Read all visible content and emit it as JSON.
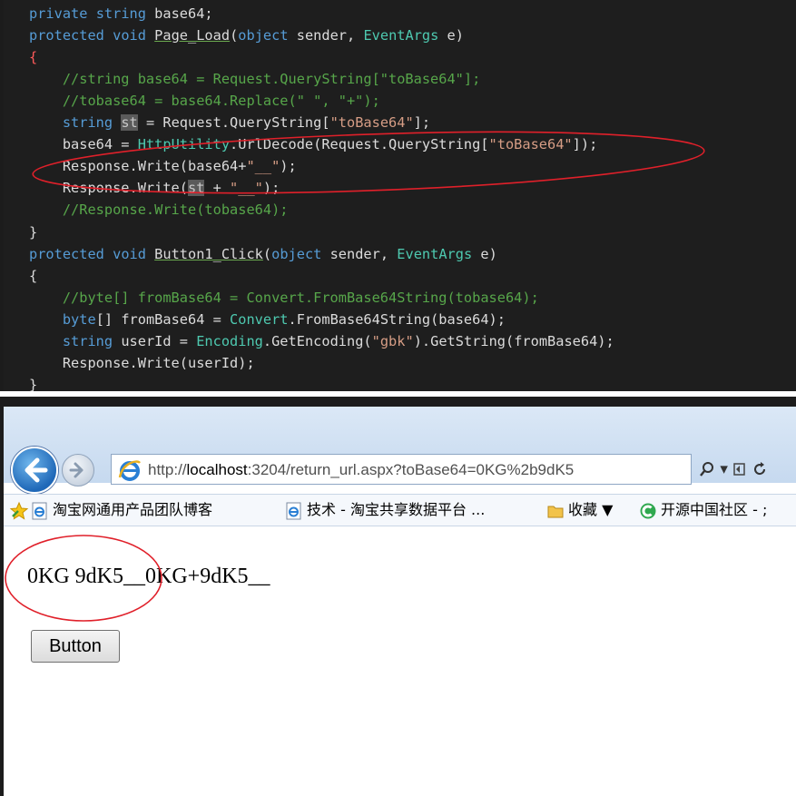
{
  "code": {
    "lines": [
      [
        {
          "t": "private ",
          "c": "kw"
        },
        {
          "t": "string ",
          "c": "kw"
        },
        {
          "t": "base64;"
        }
      ],
      [
        {
          "t": "protected ",
          "c": "kw"
        },
        {
          "t": "void ",
          "c": "kw"
        },
        {
          "t": "Page_Load",
          "c": "ul-green"
        },
        {
          "t": "("
        },
        {
          "t": "object ",
          "c": "kw"
        },
        {
          "t": "sender, "
        },
        {
          "t": "EventArgs ",
          "c": "ty"
        },
        {
          "t": "e)"
        }
      ],
      [
        {
          "t": "{",
          "c": "red-brace"
        }
      ],
      [
        {
          "t": "    //string base64 = Request.QueryString[\"toBase64\"];",
          "c": "cm"
        }
      ],
      [
        {
          "t": "    //tobase64 = base64.Replace(\" \", \"+\");",
          "c": "cm"
        }
      ],
      [
        {
          "t": "    "
        },
        {
          "t": "string ",
          "c": "kw"
        },
        {
          "t": "st",
          "c": "hl"
        },
        {
          "t": " = Request.QueryString["
        },
        {
          "t": "\"toBase64\"",
          "c": "st"
        },
        {
          "t": "];"
        }
      ],
      [
        {
          "t": "    base64 = "
        },
        {
          "t": "HttpUtility",
          "c": "ty"
        },
        {
          "t": ".UrlDecode(Request.QueryString["
        },
        {
          "t": "\"toBase64\"",
          "c": "st"
        },
        {
          "t": "]);"
        }
      ],
      [
        {
          "t": "    Response.Write(base64+"
        },
        {
          "t": "\"__\"",
          "c": "st"
        },
        {
          "t": ");"
        }
      ],
      [
        {
          "t": "    Response.Write("
        },
        {
          "t": "st",
          "c": "hl"
        },
        {
          "t": " + "
        },
        {
          "t": "\"__\"",
          "c": "st"
        },
        {
          "t": ");"
        }
      ],
      [
        {
          "t": "    //Response.Write(tobase64);",
          "c": "cm"
        }
      ],
      [
        {
          "t": "}"
        }
      ],
      [
        {
          "t": "protected ",
          "c": "kw"
        },
        {
          "t": "void ",
          "c": "kw"
        },
        {
          "t": "Button1_Click",
          "c": "ul-green"
        },
        {
          "t": "("
        },
        {
          "t": "object ",
          "c": "kw"
        },
        {
          "t": "sender, "
        },
        {
          "t": "EventArgs ",
          "c": "ty"
        },
        {
          "t": "e)"
        }
      ],
      [
        {
          "t": "{"
        }
      ],
      [
        {
          "t": "    //byte[] fromBase64 = Convert.FromBase64String(tobase64);",
          "c": "cm"
        }
      ],
      [
        {
          "t": "    "
        },
        {
          "t": "byte",
          "c": "kw"
        },
        {
          "t": "[] fromBase64 = "
        },
        {
          "t": "Convert",
          "c": "ty"
        },
        {
          "t": ".FromBase64String(base64);"
        }
      ],
      [
        {
          "t": "    "
        },
        {
          "t": "string ",
          "c": "kw"
        },
        {
          "t": "userId = "
        },
        {
          "t": "Encoding",
          "c": "ty"
        },
        {
          "t": ".GetEncoding("
        },
        {
          "t": "\"gbk\"",
          "c": "st"
        },
        {
          "t": ").GetString(fromBase64);"
        }
      ],
      [
        {
          "t": "    Response.Write(userId);"
        }
      ],
      [
        {
          "t": "}"
        }
      ]
    ],
    "annotation_color": "#e0202a"
  },
  "browser": {
    "url_scheme": "http://",
    "url_host": "localhost",
    "url_rest": ":3204/return_url.aspx?toBase64=0KG%2b9dK5",
    "search_icon": "magnifier-icon",
    "dropdown_glyph": "▾",
    "favorites": [
      {
        "label": "淘宝网通用产品团队博客",
        "icon": "ie-page-icon"
      },
      {
        "label": "技术 - 淘宝共享数据平台 ...",
        "icon": "ie-page-icon"
      },
      {
        "label": "收藏 ▼",
        "icon": "folder-icon"
      },
      {
        "label": "开源中国社区 - ;",
        "icon": "oschina-icon"
      }
    ],
    "page_text": "0KG 9dK5__0KG+9dK5__",
    "button_label": "Button"
  }
}
